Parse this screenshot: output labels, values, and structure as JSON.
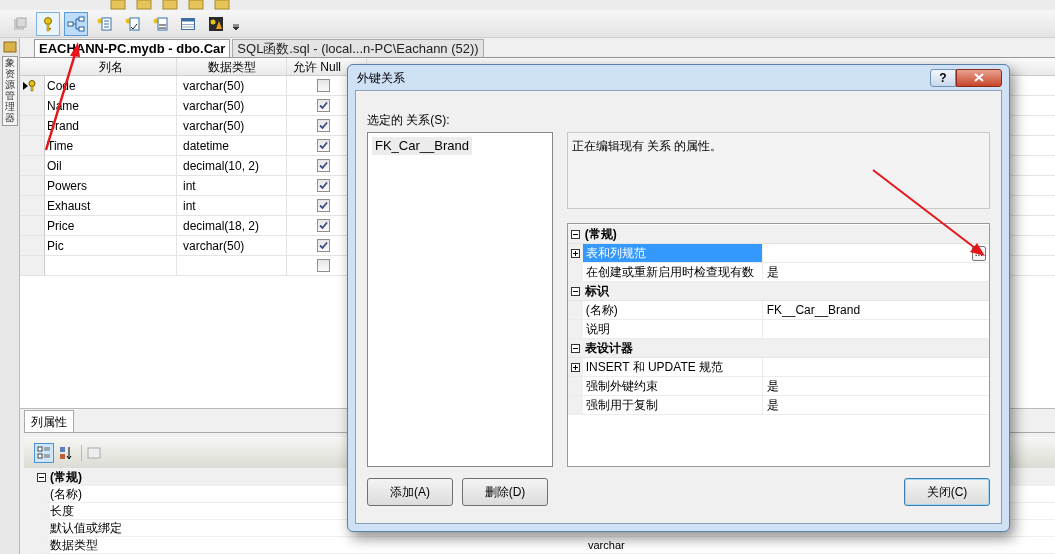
{
  "toolbar": {
    "buttons": [
      {
        "kind": "generate",
        "pressed": false
      },
      {
        "kind": "key",
        "pressed": true
      },
      {
        "kind": "relationships",
        "pressed": true
      },
      {
        "kind": "indexes",
        "pressed": false
      },
      {
        "kind": "checks",
        "pressed": false
      },
      {
        "kind": "xml",
        "pressed": false
      },
      {
        "kind": "table",
        "pressed": false
      },
      {
        "kind": "spatial",
        "pressed": false
      }
    ]
  },
  "sidebar": {
    "label": "象资源管理器"
  },
  "document_tabs": [
    {
      "label": "EACHANN-PC.mydb - dbo.Car",
      "selected": true
    },
    {
      "label": "SQL函数.sql - (local...n-PC\\Eachann (52))",
      "selected": false
    }
  ],
  "table": {
    "columns": [
      "列名",
      "数据类型",
      "允许 Null"
    ],
    "rows": [
      {
        "name": "Code",
        "type": "varchar(50)",
        "allow_null": false,
        "current": true,
        "primary_key": true
      },
      {
        "name": "Name",
        "type": "varchar(50)",
        "allow_null": true,
        "current": false,
        "primary_key": false
      },
      {
        "name": "Brand",
        "type": "varchar(50)",
        "allow_null": true,
        "current": false,
        "primary_key": false
      },
      {
        "name": "Time",
        "type": "datetime",
        "allow_null": true,
        "current": false,
        "primary_key": false
      },
      {
        "name": "Oil",
        "type": "decimal(10, 2)",
        "allow_null": true,
        "current": false,
        "primary_key": false
      },
      {
        "name": "Powers",
        "type": "int",
        "allow_null": true,
        "current": false,
        "primary_key": false
      },
      {
        "name": "Exhaust",
        "type": "int",
        "allow_null": true,
        "current": false,
        "primary_key": false
      },
      {
        "name": "Price",
        "type": "decimal(18, 2)",
        "allow_null": true,
        "current": false,
        "primary_key": false
      },
      {
        "name": "Pic",
        "type": "varchar(50)",
        "allow_null": true,
        "current": false,
        "primary_key": false
      },
      {
        "allow_null": false,
        "current": false,
        "primary_key": false
      }
    ]
  },
  "column_properties": {
    "tab": "列属性",
    "categorized": true,
    "groups": [
      {
        "label": "(常规)",
        "expanded": true,
        "rows": [
          {
            "name": "(名称)"
          },
          {
            "name": "长度"
          },
          {
            "name": "默认值或绑定"
          },
          {
            "name": "数据类型",
            "value": "varchar"
          }
        ]
      }
    ]
  },
  "dialog": {
    "title": "外键关系",
    "help_button": "?",
    "list_label": "选定的 关系(S):",
    "relations": [
      {
        "label": "FK_Car__Brand",
        "selected": true
      }
    ],
    "description": "正在编辑现有 关系 的属性。",
    "groups": [
      {
        "label": "(常规)",
        "expanded": true,
        "rows": [
          {
            "name": "表和列规范",
            "expandable": true,
            "expanded": false,
            "selected": true,
            "button": "..."
          },
          {
            "name": "在创建或重新启用时检查现有数",
            "value": "是",
            "expandable": false,
            "selected": false
          }
        ]
      },
      {
        "label": "标识",
        "expanded": true,
        "rows": [
          {
            "name": "(名称)",
            "value": "FK__Car__Brand",
            "expandable": false,
            "selected": false
          },
          {
            "name": "说明",
            "expandable": false,
            "selected": false
          }
        ]
      },
      {
        "label": "表设计器",
        "expanded": true,
        "rows": [
          {
            "name": "INSERT 和 UPDATE 规范",
            "expandable": true,
            "expanded": false,
            "selected": false
          },
          {
            "name": "强制外键约束",
            "value": "是",
            "expandable": false,
            "selected": false
          },
          {
            "name": "强制用于复制",
            "value": "是",
            "expandable": false,
            "selected": false
          }
        ]
      }
    ],
    "buttons": [
      {
        "label": "添加(A)",
        "kind": "left",
        "default": false
      },
      {
        "label": "删除(D)",
        "kind": "left",
        "default": false
      },
      {
        "label": "关闭(C)",
        "kind": "right",
        "default": true
      }
    ]
  }
}
